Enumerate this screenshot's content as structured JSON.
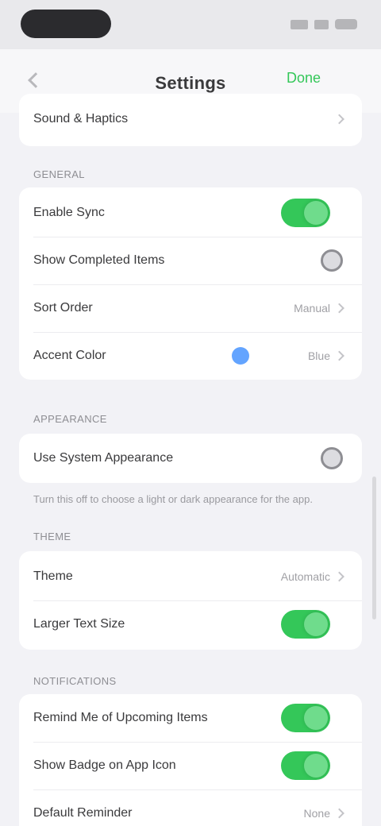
{
  "nav": {
    "title": "Settings",
    "action": "Done"
  },
  "top_card": {
    "label": "Sound & Haptics"
  },
  "general": {
    "header": "General",
    "rows": [
      {
        "label": "Enable Sync",
        "control": "toggle",
        "on": true
      },
      {
        "label": "Show Completed Items",
        "control": "radio"
      },
      {
        "label": "Sort Order",
        "value": "Manual"
      },
      {
        "label": "Accent Color",
        "value": "Blue"
      }
    ]
  },
  "appearance": {
    "header": "Appearance",
    "row_label": "Use System Appearance",
    "footnote": "Turn this off to choose a light or dark appearance for the app.",
    "footnote_tail": "Theme"
  },
  "display": {
    "rows": [
      {
        "label": "Theme",
        "value": "Automatic"
      },
      {
        "label": "Larger Text Size",
        "control": "toggle",
        "on": true
      }
    ]
  },
  "notifications": {
    "header": "Notifications",
    "rows": [
      {
        "label": "Remind Me of Upcoming Items",
        "control": "toggle",
        "on": true
      },
      {
        "label": "Show Badge on App Icon",
        "control": "toggle",
        "on": true
      },
      {
        "label": "Default Reminder",
        "value": "None"
      }
    ]
  },
  "colors": {
    "accent": "#34c759",
    "link": "#2f86ff",
    "background": "#f2f2f6"
  }
}
